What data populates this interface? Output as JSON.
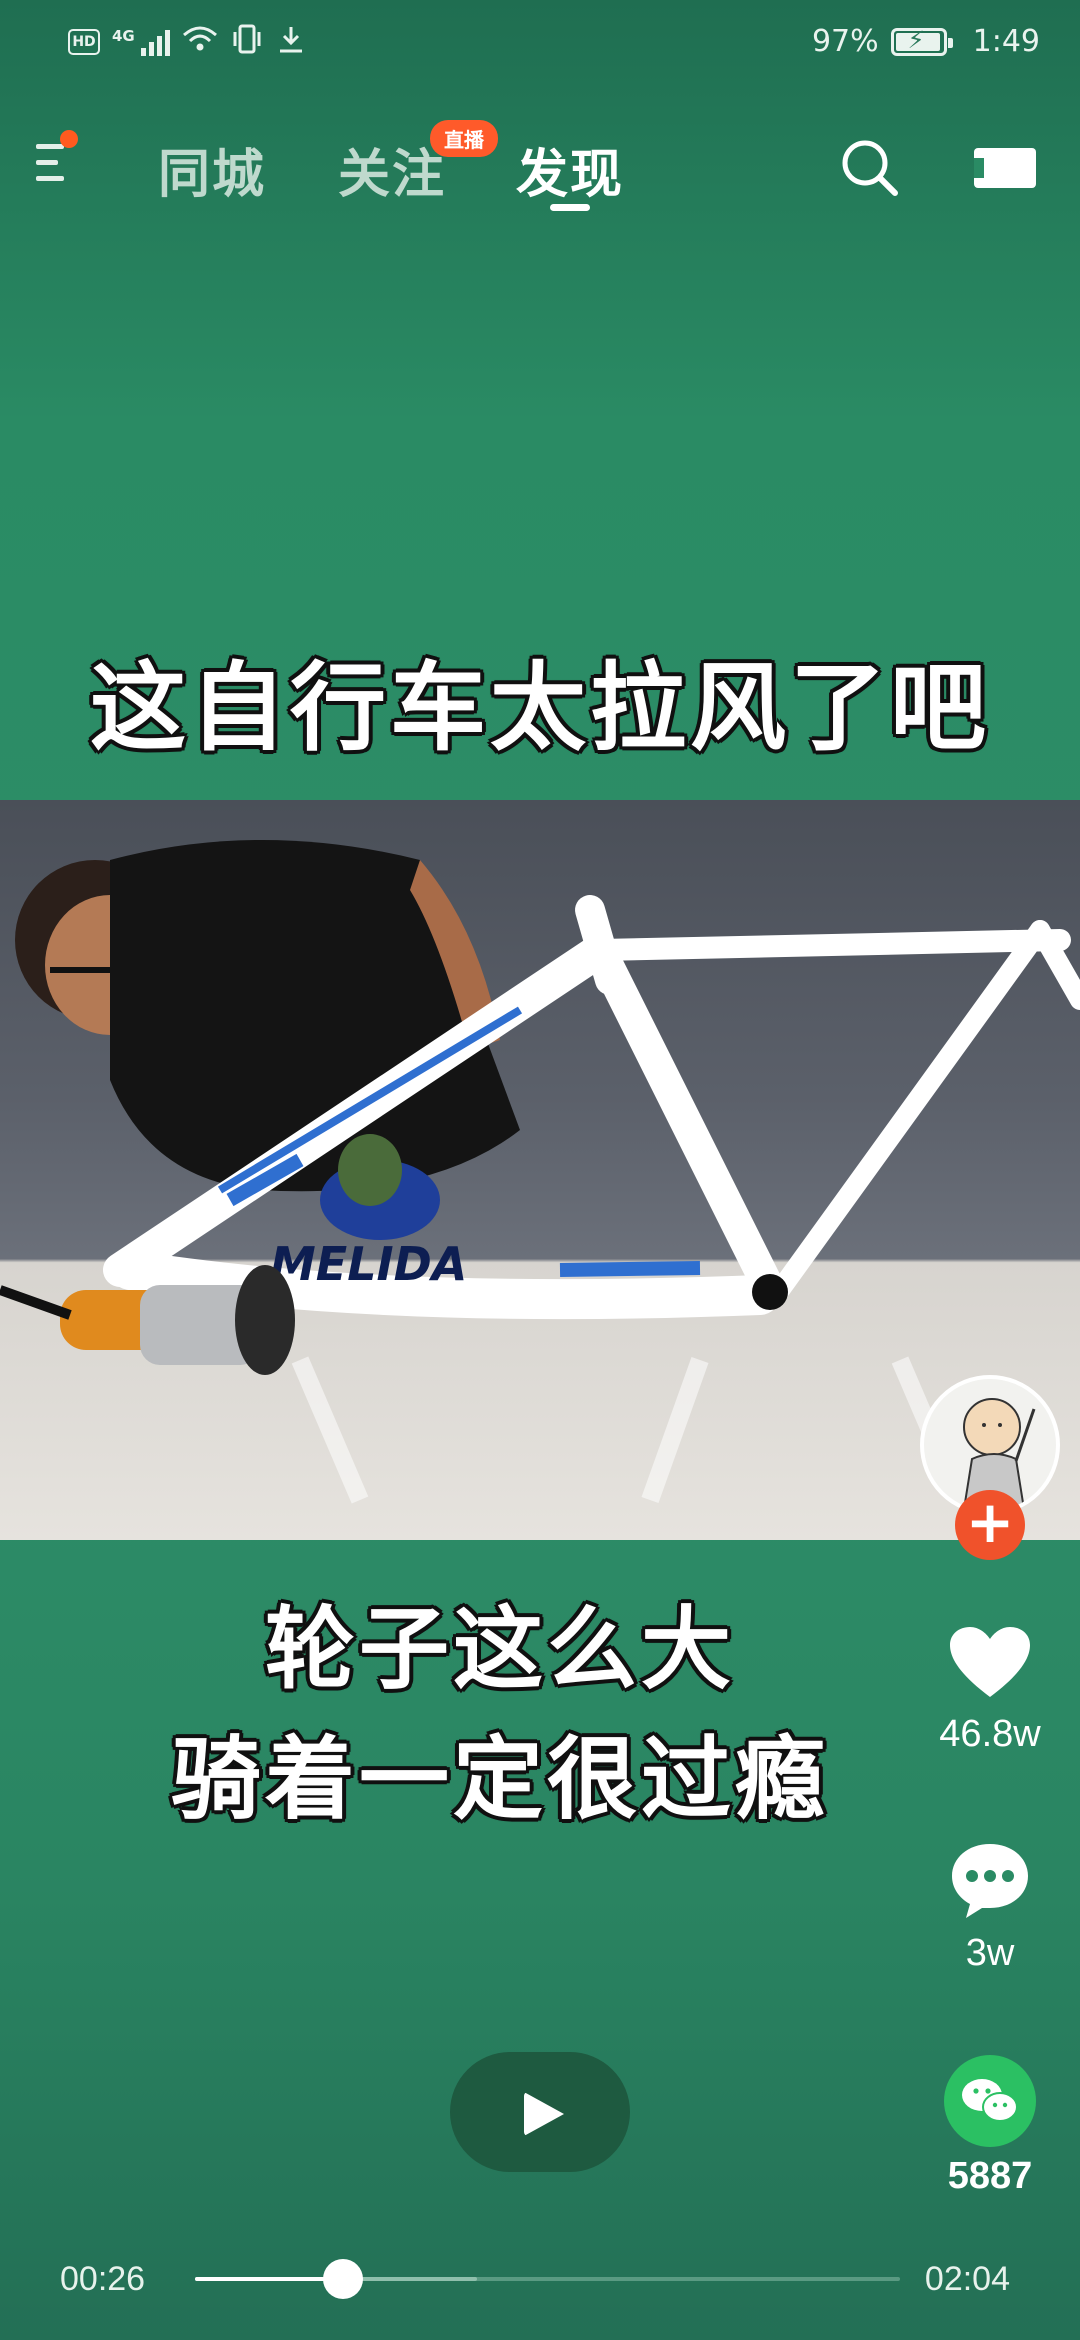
{
  "status_bar": {
    "hd": "HD",
    "network": "4G",
    "battery": "97%",
    "time": "1:49"
  },
  "nav": {
    "tabs": [
      {
        "label": "同城"
      },
      {
        "label": "关注",
        "badge": "直播"
      },
      {
        "label": "发现",
        "active": true
      }
    ]
  },
  "video": {
    "caption_top": "这自行车太拉风了吧",
    "caption_bottom_line1": "轮子这么大",
    "caption_bottom_line2": "骑着一定很过瘾",
    "frame_text": "MELIDA"
  },
  "actions": {
    "likes": "46.8w",
    "comments": "3w",
    "shares": "5887"
  },
  "player": {
    "current_time": "00:26",
    "duration": "02:04",
    "progress_fraction": 0.21,
    "buffered_fraction": 0.4
  },
  "colors": {
    "accent": "#ff5a1f",
    "follow": "#f0522b",
    "wechat": "#2bc063",
    "background": "#2a8b64"
  },
  "icons": [
    "menu-icon",
    "search-icon",
    "camera-icon",
    "heart-icon",
    "comment-icon",
    "wechat-icon",
    "play-icon"
  ]
}
